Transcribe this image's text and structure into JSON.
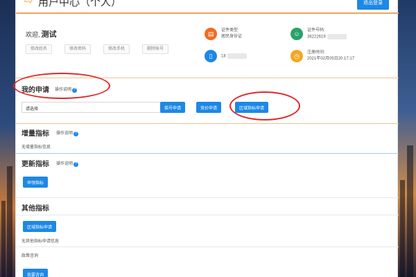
{
  "header": {
    "tag": "⇨",
    "title": "用户中心（个人）",
    "logout_label": "退出登录"
  },
  "user": {
    "greeting": "欢迎,",
    "name": "测试",
    "actions": [
      "修改姓名",
      "修改密码",
      "修改手机",
      "删除帐号"
    ]
  },
  "info": {
    "id_type_label": "证件类型:",
    "id_type_value": "居民身份证",
    "id_number_label": "证件号码:",
    "id_number_value": "36222619",
    "phone_value": "18",
    "reg_time_label": "注册时间:",
    "reg_time_value": "2021年02月05日20:17:17",
    "colors": {
      "id_type": "#f26b21",
      "id_number": "#27a36a",
      "phone": "#1d88e5",
      "reg_time": "#f5a623"
    }
  },
  "my_apply": {
    "title": "我的申请",
    "help": "操作说明",
    "select_value": "请选择",
    "buttons": [
      "摇号申请",
      "竞价申请",
      "区域指标申请"
    ]
  },
  "increment": {
    "title": "增量指标",
    "help": "操作说明",
    "empty": "无增量指标信息"
  },
  "renew": {
    "title": "更新指标",
    "help": "操作说明",
    "button": "申领指标"
  },
  "other": {
    "title": "其他指标",
    "button": "区域指标申请",
    "empty": "无其他指标申请信息"
  },
  "consult": {
    "title": "政策咨询",
    "button": "我要咨询"
  },
  "annotation_color": "#e02626"
}
